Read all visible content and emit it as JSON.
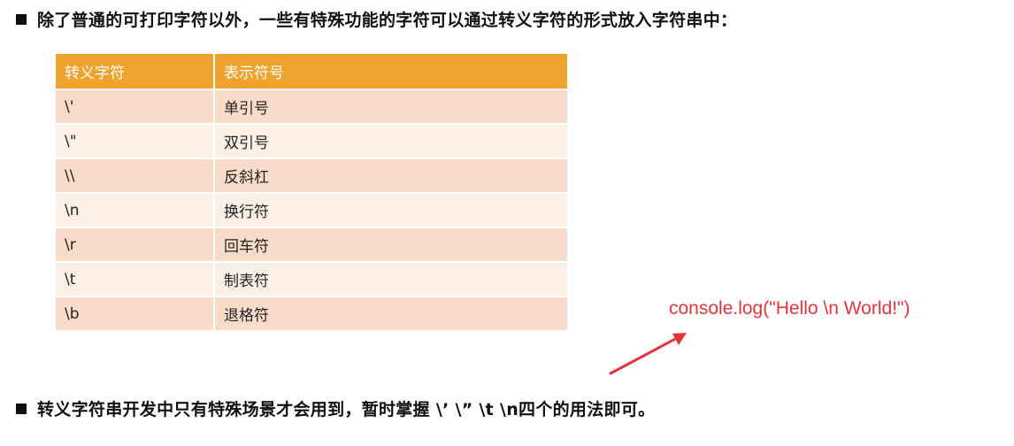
{
  "intro_text": "除了普通的可打印字符以外，一些有特殊功能的字符可以通过转义字符的形式放入字符串中：",
  "table": {
    "headers": [
      "转义字符",
      "表示符号"
    ],
    "rows": [
      [
        "\\'",
        "单引号"
      ],
      [
        "\\\"",
        "双引号"
      ],
      [
        "\\\\",
        "反斜杠"
      ],
      [
        "\\n",
        "换行符"
      ],
      [
        "\\r",
        "回车符"
      ],
      [
        "\\t",
        "制表符"
      ],
      [
        "\\b",
        "退格符"
      ]
    ]
  },
  "annotation": {
    "code": "console.log(\"Hello \\n World!\")",
    "color": "#e3343a"
  },
  "summary_text": "转义字符串开发中只有特殊场景才会用到，暂时掌握 \\’ \\” \\t  \\n四个的用法即可。",
  "colors": {
    "header_bg": "#f0a22e",
    "row_odd": "#f8dbc9",
    "row_even": "#fcefe6"
  }
}
